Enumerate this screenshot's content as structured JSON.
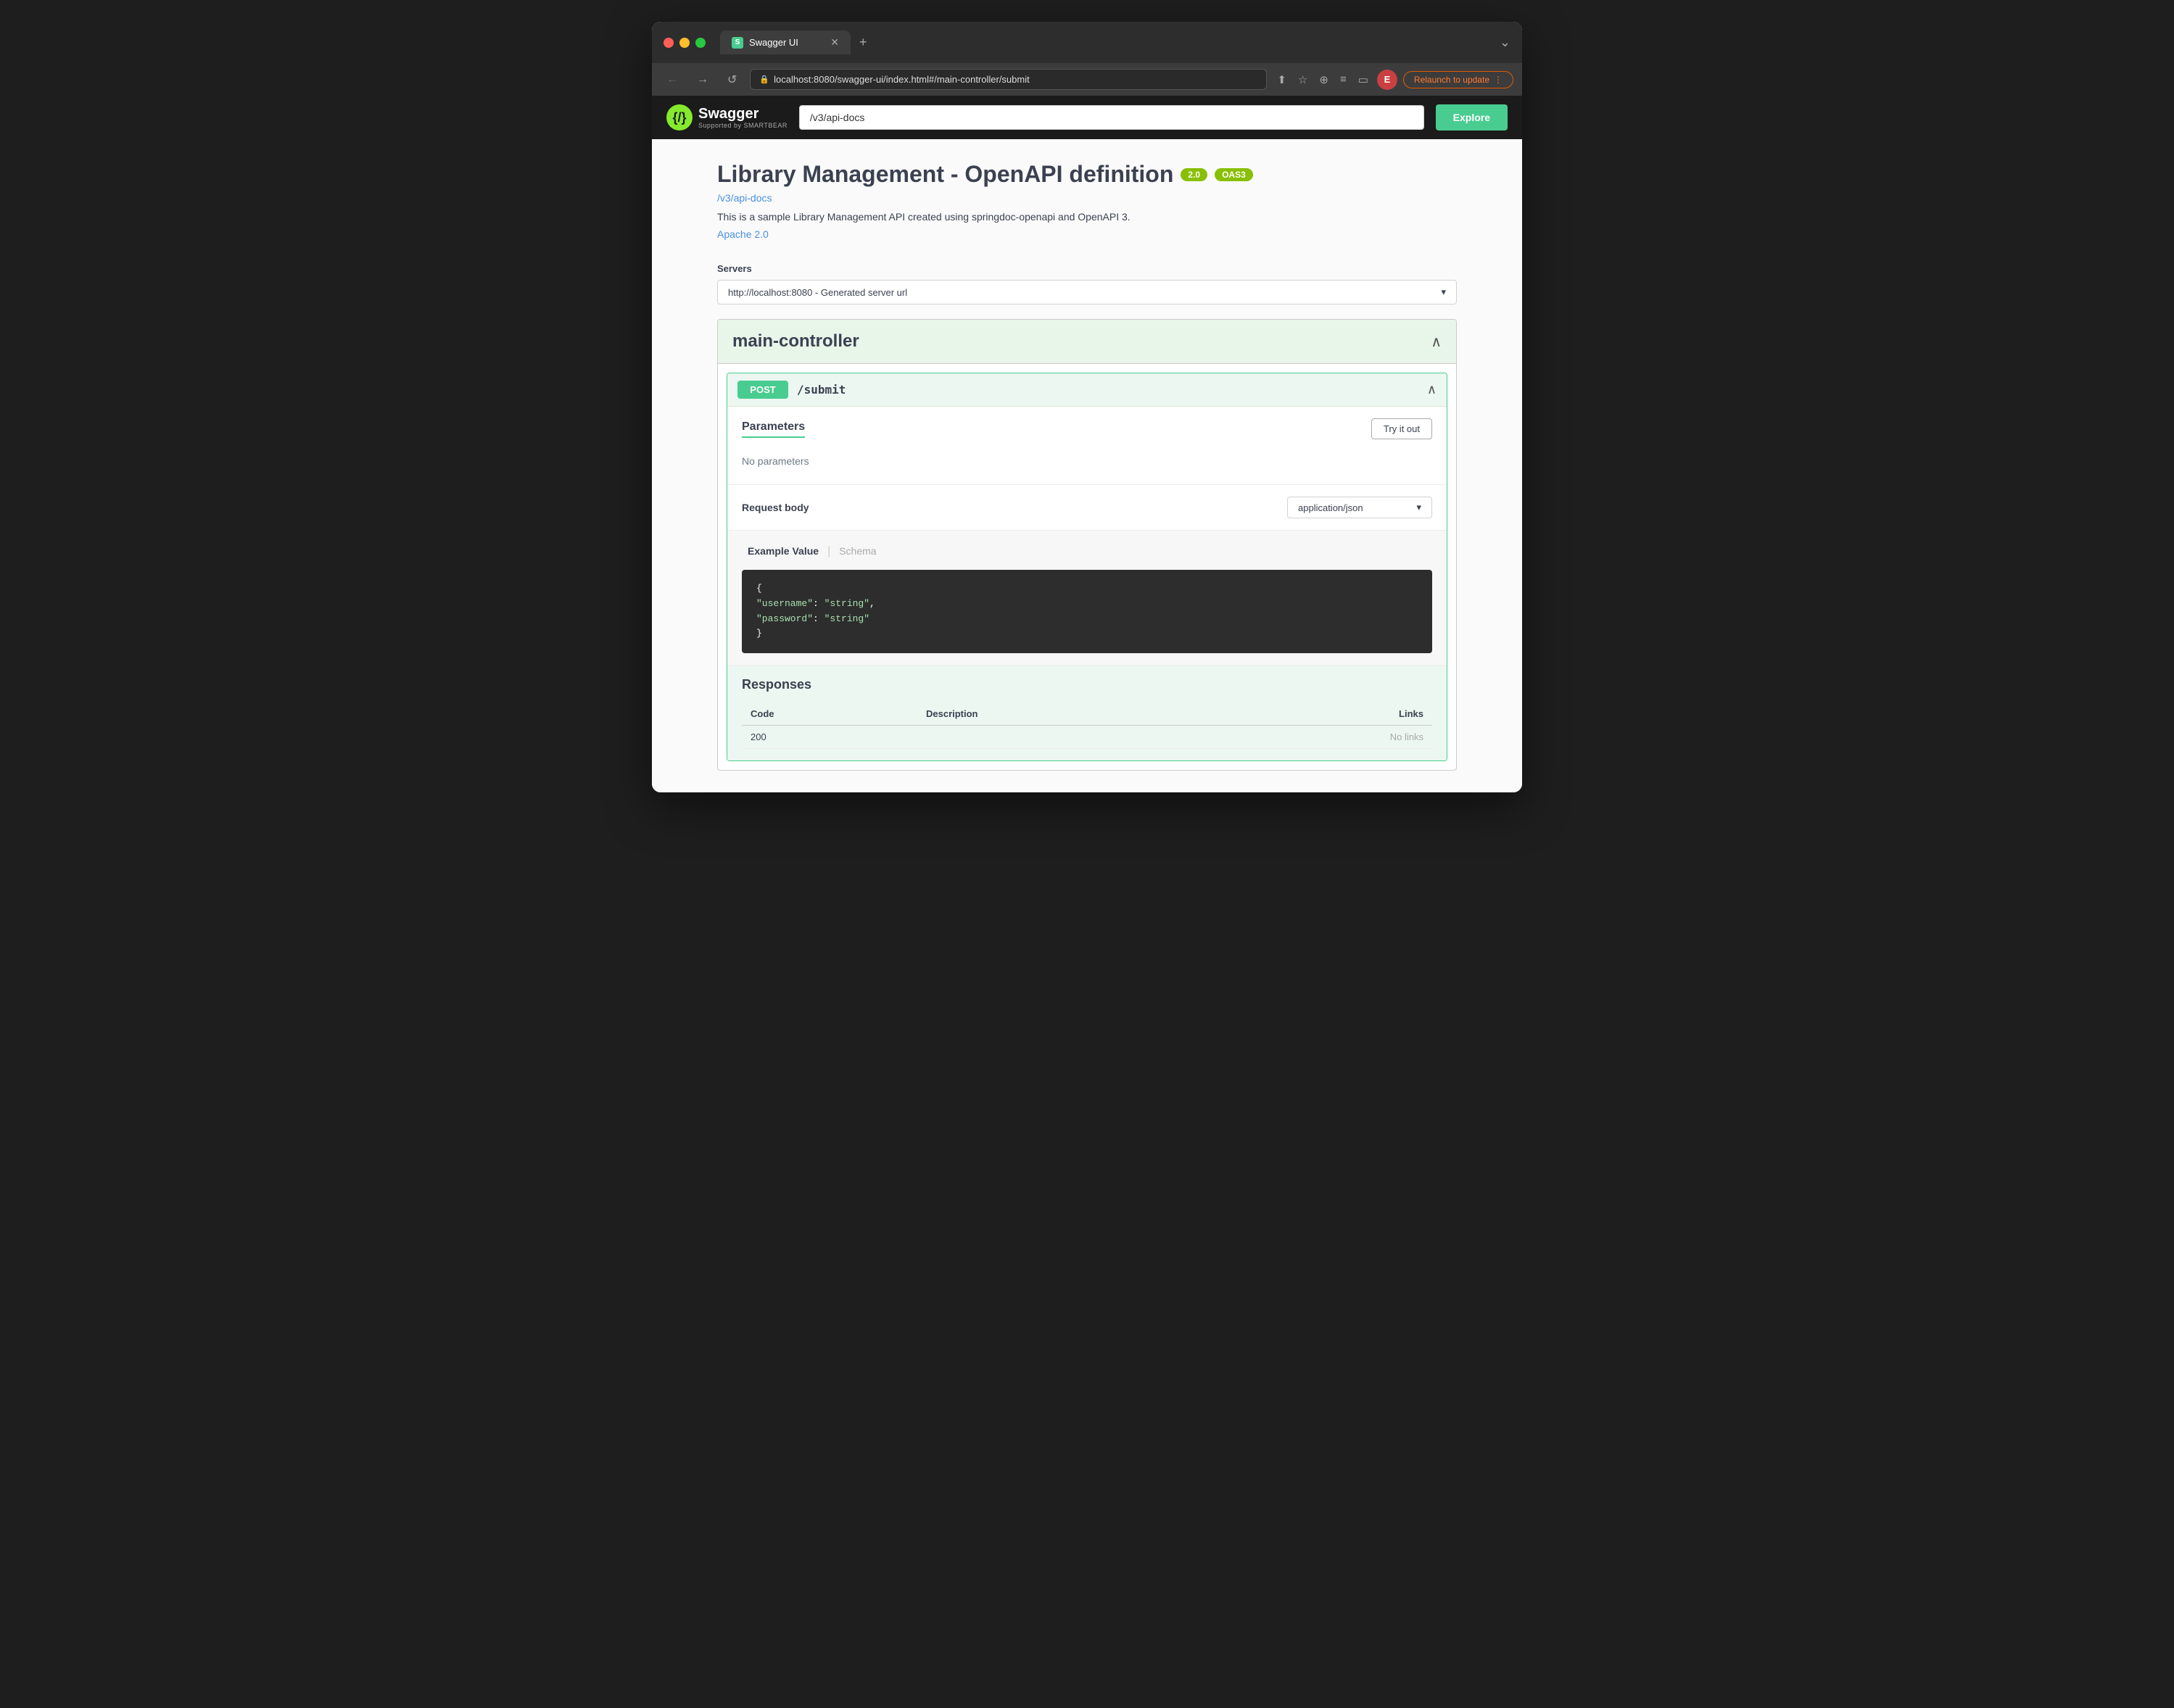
{
  "browser": {
    "tab_title": "Swagger UI",
    "url": "localhost:8080/swagger-ui/index.html#/main-controller/submit",
    "relaunch_btn": "Relaunch to update",
    "new_tab_icon": "+",
    "back_icon": "←",
    "forward_icon": "→",
    "refresh_icon": "↺",
    "user_initial": "E"
  },
  "swagger": {
    "logo_name": "Swagger",
    "logo_sub": "Supported by SMARTBEAR",
    "search_value": "/v3/api-docs",
    "search_placeholder": "/v3/api-docs",
    "explore_btn": "Explore"
  },
  "api": {
    "title": "Library Management - OpenAPI definition",
    "badge_version": "2.0",
    "badge_oas": "OAS3",
    "docs_link": "/v3/api-docs",
    "description": "This is a sample Library Management API created using springdoc-openapi and OpenAPI 3.",
    "license": "Apache 2.0"
  },
  "servers": {
    "label": "Servers",
    "selected": "http://localhost:8080 - Generated server url"
  },
  "controller": {
    "name": "main-controller"
  },
  "endpoint": {
    "method": "POST",
    "path": "/submit",
    "parameters_title": "Parameters",
    "try_it_out_btn": "Try it out",
    "no_parameters": "No parameters",
    "request_body_label": "Request body",
    "content_type": "application/json",
    "example_tab_active": "Example Value",
    "example_tab_inactive": "Schema",
    "code": [
      "{",
      "  \"username\": \"string\",",
      "  \"password\": \"string\"",
      "}"
    ],
    "responses_title": "Responses",
    "responses_col_code": "Code",
    "responses_col_description": "Description",
    "responses_col_links": "Links",
    "response_code": "200",
    "response_links": "No links"
  }
}
